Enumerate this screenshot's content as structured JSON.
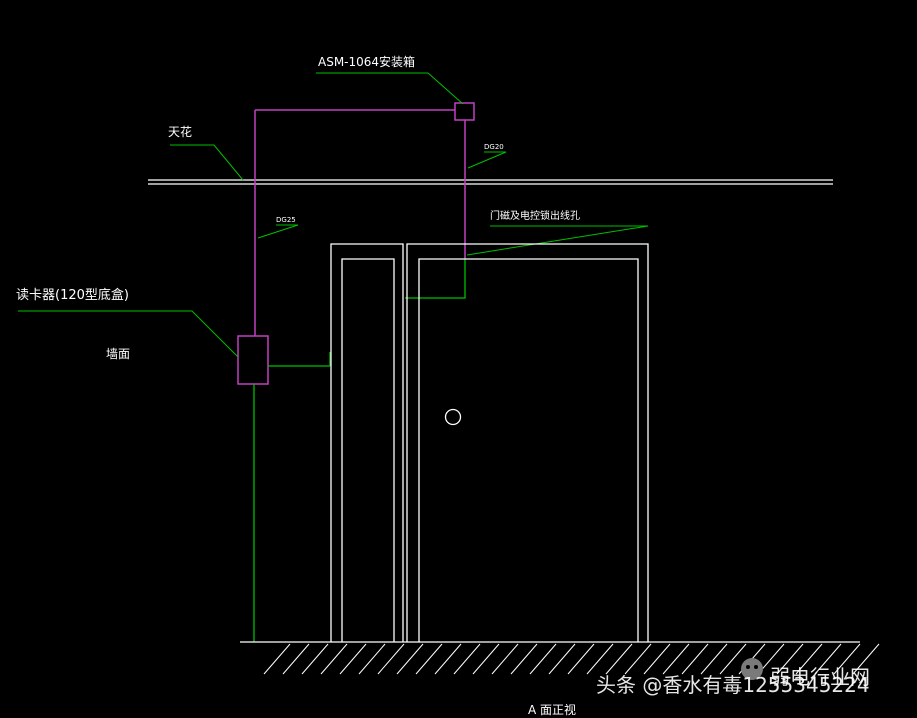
{
  "labels": {
    "asm_box": "ASM-1064安装箱",
    "ceiling": "天花",
    "dg20": "DG20",
    "door_outlet": "门磁及电控锁出线孔",
    "dg25": "DG25",
    "card_reader": "读卡器(120型底盒)",
    "wall": "墙面",
    "view_title": "A 面正视"
  },
  "watermark": {
    "source": "头条 @香水有毒1255345224",
    "brand": "弱电行业网"
  },
  "colors": {
    "background": "#000000",
    "line_white": "#ffffff",
    "line_green": "#00c000",
    "line_magenta": "#c040c0"
  }
}
